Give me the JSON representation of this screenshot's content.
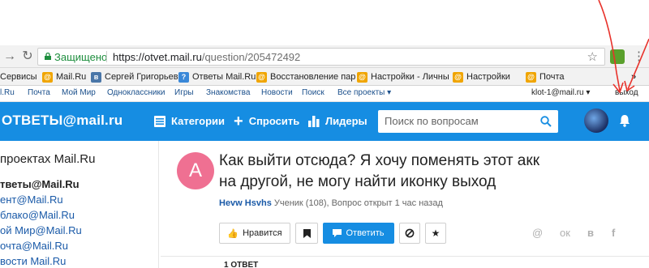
{
  "browser": {
    "secure_label": "Защищено",
    "url_host": "https://otvet.mail.ru",
    "url_path": "/question/205472492",
    "back_icon": "arrow-right-icon",
    "reload_icon": "reload-icon"
  },
  "bookmarks": [
    {
      "label": "Сервисы",
      "icon": "apps-icon"
    },
    {
      "label": "Mail.Ru",
      "icon": "at-icon"
    },
    {
      "label": "Сергей Григорьев",
      "icon": "vk-icon"
    },
    {
      "label": "Ответы Mail.Ru",
      "icon": "question-icon"
    },
    {
      "label": "Восстановление пар",
      "icon": "at-icon"
    },
    {
      "label": "Настройки - Личны",
      "icon": "at-icon"
    },
    {
      "label": "Настройки",
      "icon": "at-icon"
    },
    {
      "label": "Почта",
      "icon": "at-icon"
    }
  ],
  "bookmarks_more": "»",
  "portal": {
    "links": [
      "l.Ru",
      "Почта",
      "Мой Мир",
      "Одноклассники",
      "Игры",
      "Знакомства",
      "Новости",
      "Поиск",
      "Все проекты"
    ],
    "user": "klot-1@mail.ru",
    "logout": "выход"
  },
  "header": {
    "logo": "ОТВЕТЫ@mail.ru",
    "nav": [
      {
        "label": "Категории",
        "icon": "categories-icon"
      },
      {
        "label": "Спросить",
        "icon": "plus-icon"
      },
      {
        "label": "Лидеры",
        "icon": "leaders-icon"
      }
    ],
    "search_placeholder": "Поиск по вопросам"
  },
  "sidebar": {
    "heading": "проектах Mail.Ru",
    "items": [
      "тветы@Mail.Ru",
      "ент@Mail.Ru",
      "блако@Mail.Ru",
      "ой Мир@Mail.Ru",
      "очта@Mail.Ru",
      "вости Mail.Ru"
    ]
  },
  "question": {
    "avatar_letter": "A",
    "title": "Как выйти отсюда? Я хочу поменять этот акк на другой, не могу найти иконку выход",
    "author": "Hevw Hsvhs",
    "meta": "Ученик (108), Вопрос открыт 1 час назад",
    "like_label": "Нравится",
    "answer_label": "Ответить",
    "answers_count": "1 ОТВЕТ"
  },
  "colors": {
    "accent": "#168de2",
    "highlight": "#ffff33",
    "arrow": "#e8322b"
  }
}
